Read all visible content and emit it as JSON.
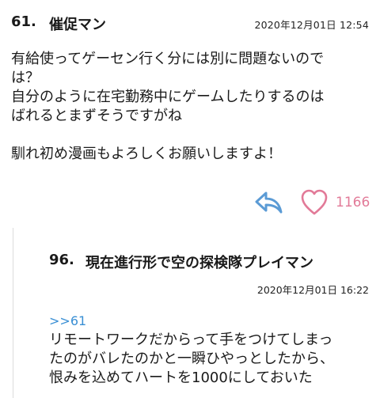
{
  "comment": {
    "number": "61.",
    "name": "催促マン",
    "date": "2020年12月01日 12:54",
    "lines": [
      "有給使ってゲーセン行く分には別に問題ないので",
      "は？",
      "自分のように在宅勤務中にゲームしたりするのは",
      "ばれるとまずそうですがね",
      "",
      "馴れ初め漫画もよろしくお願いしますよ！"
    ],
    "like_count": "1166"
  },
  "reply": {
    "number": "96.",
    "name": "現在進行形で空の探検隊プレイマン",
    "date": "2020年12月01日 16:22",
    "anchor": ">>61",
    "lines": [
      "リモートワークだからって手をつけてしまっ",
      "たのがバレたのかと一瞬ひやっとしたから、",
      "恨みを込めてハートを1000にしておいた"
    ]
  },
  "colors": {
    "reply_icon": "#5b9bd5",
    "heart_icon": "#e27a98",
    "anchor_link": "#3a8fd4"
  }
}
